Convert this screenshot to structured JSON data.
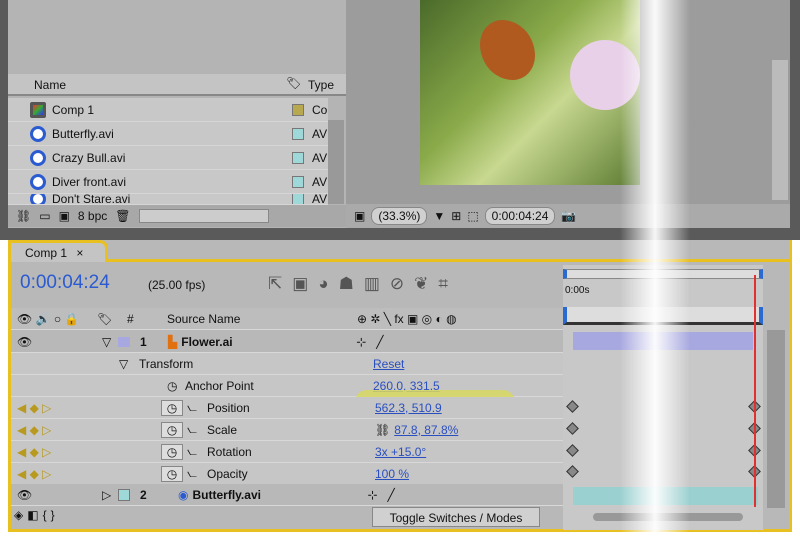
{
  "project": {
    "columns": {
      "name": "Name",
      "type": "Type"
    },
    "items": [
      {
        "name": "Comp 1",
        "type": "Co"
      },
      {
        "name": "Butterfly.avi",
        "type": "AV"
      },
      {
        "name": "Crazy Bull.avi",
        "type": "AV"
      },
      {
        "name": "Diver front.avi",
        "type": "AV"
      },
      {
        "name": "Don't Stare.avi",
        "type": "AV"
      }
    ],
    "bit_depth": "8 bpc"
  },
  "viewer": {
    "zoom": "(33.3%)",
    "timecode": "0:00:04:24"
  },
  "timeline": {
    "tab": "Comp 1",
    "close": "×",
    "current_time": "0:00:04:24",
    "fps": "(25.00 fps)",
    "ruler_start": "0:00s",
    "columns": {
      "num": "#",
      "source": "Source Name",
      "switches": "⊕ ✲ ╲ fx ▣ ◎ ◐ ◍"
    },
    "layers": [
      {
        "num": "1",
        "name": "Flower.ai"
      },
      {
        "num": "2",
        "name": "Butterfly.avi"
      }
    ],
    "transform": {
      "label": "Transform",
      "reset": "Reset"
    },
    "properties": [
      {
        "name": "Anchor Point",
        "value": "260.0, 331.5"
      },
      {
        "name": "Position",
        "value": "562.3, 510.9"
      },
      {
        "name": "Scale",
        "value": "87.8, 87.8%"
      },
      {
        "name": "Rotation",
        "value": "3x +15.0°"
      },
      {
        "name": "Opacity",
        "value": "100 %"
      }
    ],
    "toggle": "Toggle Switches / Modes"
  }
}
